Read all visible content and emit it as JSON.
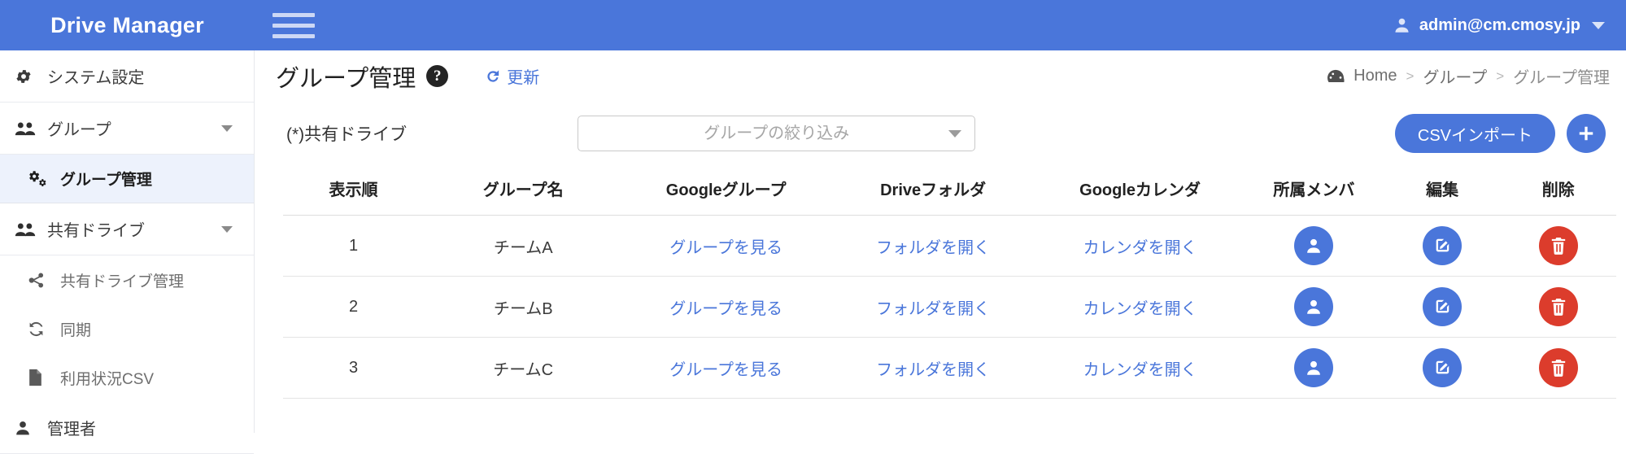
{
  "topbar": {
    "brand": "Drive Manager",
    "menu_icon": "hamburger-icon",
    "account_label": "admin@cm.cmosy.jp",
    "account_icon": "user-icon",
    "caret_icon": "chevron-down-icon",
    "bg_color": "#4a76da"
  },
  "sidebar": {
    "items": [
      {
        "label": "システム設定",
        "icon": "gear-icon",
        "level": "top",
        "active": false,
        "chevron": false
      },
      {
        "label": "グループ",
        "icon": "users-icon",
        "level": "top",
        "active": false,
        "chevron": true
      },
      {
        "label": "グループ管理",
        "icon": "cogs-icon",
        "level": "sub",
        "active": true,
        "chevron": false
      },
      {
        "label": "共有ドライブ",
        "icon": "users-icon",
        "level": "top",
        "active": false,
        "chevron": true
      },
      {
        "label": "共有ドライブ管理",
        "icon": "share-icon",
        "level": "sub",
        "active": false,
        "chevron": false
      },
      {
        "label": "同期",
        "icon": "sync-icon",
        "level": "sub",
        "active": false,
        "chevron": false
      },
      {
        "label": "利用状況CSV",
        "icon": "file-icon",
        "level": "sub",
        "active": false,
        "chevron": false
      },
      {
        "label": "管理者",
        "icon": "user-icon",
        "level": "top",
        "active": false,
        "chevron": false
      }
    ]
  },
  "page": {
    "title": "グループ管理",
    "help_icon": "question-mark-icon",
    "help_label": "?",
    "refresh_label": "更新",
    "refresh_icon": "refresh-icon"
  },
  "breadcrumb": {
    "home_icon": "tachometer-icon",
    "items": [
      {
        "label": "Home",
        "current": false
      },
      {
        "label": "グループ",
        "current": false
      },
      {
        "label": "グループ管理",
        "current": true
      }
    ],
    "separator": ">"
  },
  "toolbar": {
    "shared_drive_label": "(*)共有ドライブ",
    "filter_placeholder": "グループの絞り込み",
    "filter_value": "",
    "filter_caret_icon": "caret-down-icon",
    "csv_import_label": "CSVインポート",
    "add_label": "+",
    "add_icon": "plus-icon",
    "accent_color": "#4a76da"
  },
  "table": {
    "headers": [
      "表示順",
      "グループ名",
      "Googleグループ",
      "Driveフォルダ",
      "Googleカレンダ",
      "所属メンバ",
      "編集",
      "削除"
    ],
    "link_labels": {
      "google_group": "グループを見る",
      "drive_folder": "フォルダを開く",
      "google_calendar": "カレンダを開く"
    },
    "action_icons": {
      "members": "user-icon",
      "edit": "edit-square-icon",
      "delete": "trash-icon"
    },
    "action_colors": {
      "members": "#4a76da",
      "edit": "#4a76da",
      "delete": "#dc3c2c"
    },
    "rows": [
      {
        "order": "1",
        "name": "チームA",
        "google_group": "グループを見る",
        "drive_folder": "フォルダを開く",
        "google_calendar": "カレンダを開く"
      },
      {
        "order": "2",
        "name": "チームB",
        "google_group": "グループを見る",
        "drive_folder": "フォルダを開く",
        "google_calendar": "カレンダを開く"
      },
      {
        "order": "3",
        "name": "チームC",
        "google_group": "グループを見る",
        "drive_folder": "フォルダを開く",
        "google_calendar": "カレンダを開く"
      }
    ]
  }
}
